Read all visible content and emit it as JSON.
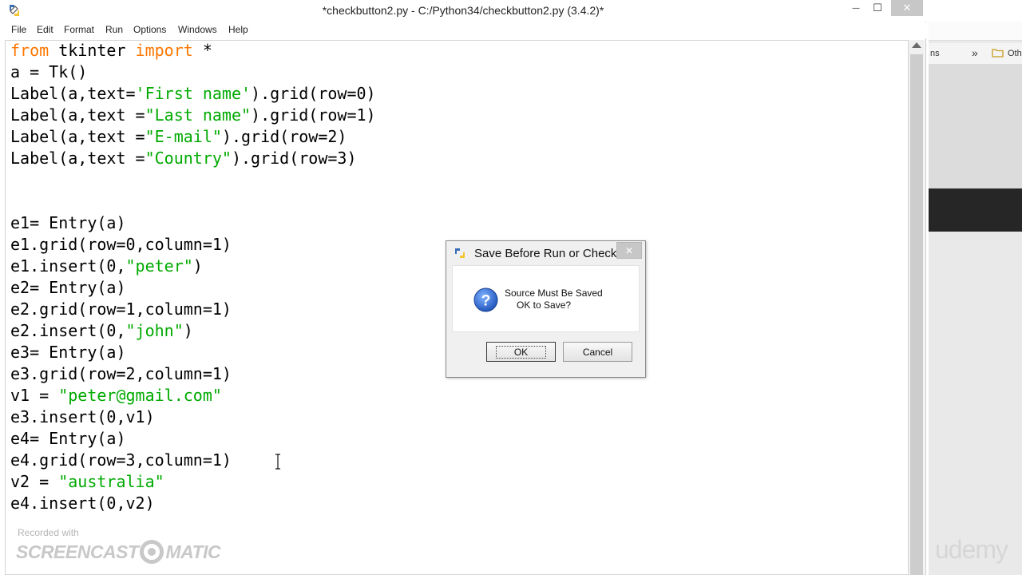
{
  "window": {
    "title": "*checkbutton2.py - C:/Python34/checkbutton2.py (3.4.2)*",
    "minimize_glyph": "—",
    "maximize_glyph": "☐",
    "close_glyph": "✕"
  },
  "menu": [
    "File",
    "Edit",
    "Format",
    "Run",
    "Options",
    "Windows",
    "Help"
  ],
  "code_lines": [
    [
      {
        "t": "from",
        "c": "kw"
      },
      {
        "t": " tkinter "
      },
      {
        "t": "import",
        "c": "kw"
      },
      {
        "t": " *"
      }
    ],
    [
      {
        "t": "a = Tk()"
      }
    ],
    [
      {
        "t": "Label(a,text="
      },
      {
        "t": "'First name'",
        "c": "str"
      },
      {
        "t": ").grid(row=0)"
      }
    ],
    [
      {
        "t": "Label(a,text ="
      },
      {
        "t": "\"Last name\"",
        "c": "str"
      },
      {
        "t": ").grid(row=1)"
      }
    ],
    [
      {
        "t": "Label(a,text ="
      },
      {
        "t": "\"E-mail\"",
        "c": "str"
      },
      {
        "t": ").grid(row=2)"
      }
    ],
    [
      {
        "t": "Label(a,text ="
      },
      {
        "t": "\"Country\"",
        "c": "str"
      },
      {
        "t": ").grid(row=3)"
      }
    ],
    [],
    [],
    [
      {
        "t": "e1= Entry(a)"
      }
    ],
    [
      {
        "t": "e1.grid(row=0,column=1)"
      }
    ],
    [
      {
        "t": "e1.insert(0,"
      },
      {
        "t": "\"peter\"",
        "c": "str"
      },
      {
        "t": ")"
      }
    ],
    [
      {
        "t": "e2= Entry(a)"
      }
    ],
    [
      {
        "t": "e2.grid(row=1,column=1)"
      }
    ],
    [
      {
        "t": "e2.insert(0,"
      },
      {
        "t": "\"john\"",
        "c": "str"
      },
      {
        "t": ")"
      }
    ],
    [
      {
        "t": "e3= Entry(a)"
      }
    ],
    [
      {
        "t": "e3.grid(row=2,column=1)"
      }
    ],
    [
      {
        "t": "v1 = "
      },
      {
        "t": "\"peter@gmail.com\"",
        "c": "str"
      }
    ],
    [
      {
        "t": "e3.insert(0,v1)"
      }
    ],
    [
      {
        "t": "e4= Entry(a)"
      }
    ],
    [
      {
        "t": "e4.grid(row=3,column=1)"
      }
    ],
    [
      {
        "t": "v2 = "
      },
      {
        "t": "\"australia\"",
        "c": "str"
      }
    ],
    [
      {
        "t": "e4.insert(0,v2)"
      }
    ]
  ],
  "syntax_colors": {
    "keyword": "#ff7700",
    "string": "#00aa00",
    "text": "#000000"
  },
  "dialog": {
    "title": "Save Before Run or Check",
    "close_glyph": "✕",
    "icon": "question-icon",
    "message_line1": "Source Must Be Saved",
    "message_line2": "OK to Save?",
    "ok_label": "OK",
    "cancel_label": "Cancel"
  },
  "browser": {
    "bookmark_fragment": "ns",
    "chevron": "»",
    "other_bookmark": "Oth",
    "watermark": "udemy"
  },
  "screencast": {
    "recorded_with": "Recorded with",
    "logo_left": "SCREENCAST",
    "logo_right": "MATIC"
  }
}
